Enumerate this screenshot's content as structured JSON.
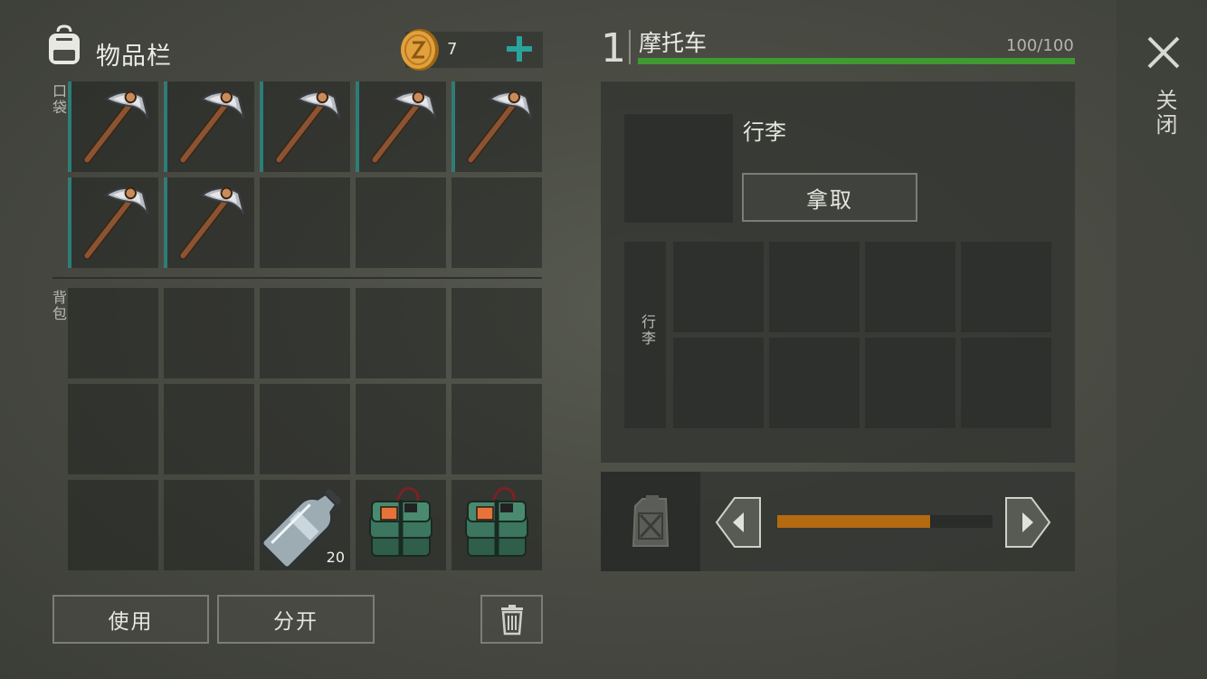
{
  "inventory": {
    "title": "物品栏",
    "coin_count": "7",
    "pocket_label": "口袋",
    "backpack_label": "背包",
    "pocket_slots": [
      "pickaxe",
      "pickaxe",
      "pickaxe",
      "pickaxe",
      "pickaxe",
      "pickaxe",
      "pickaxe",
      "",
      "",
      ""
    ],
    "backpack_slots": [
      "",
      "",
      "",
      "",
      "",
      "",
      "",
      "",
      "",
      "",
      "",
      "",
      "water-bottle",
      "c4-explosive",
      "c4-explosive"
    ],
    "bottle_qty": "20",
    "use_label": "使用",
    "split_label": "分开"
  },
  "vehicle": {
    "number": "1",
    "name": "摩托车",
    "hp_text": "100/100",
    "hp_fraction": 1.0,
    "trunk_title": "行李",
    "take_label": "拿取",
    "trunk_tab_label": "行李",
    "fuel_fraction": 0.71
  },
  "close_label": "关闭",
  "colors": {
    "accent_green": "#3e9a31",
    "fuel_orange": "#b36a10",
    "pocket_teal": "#2f7c78",
    "plus_teal": "#2aa39c"
  }
}
